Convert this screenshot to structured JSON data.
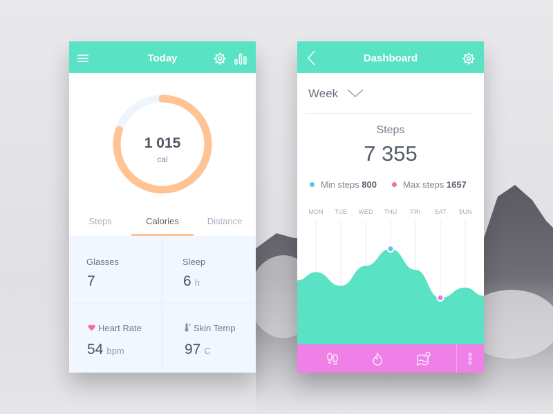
{
  "colors": {
    "teal": "#59e2c4",
    "orange": "#ffc394",
    "ring_track": "#eef5fd",
    "pink_bar": "#ef80e8",
    "min_dot": "#5cc2f0",
    "max_dot": "#ee6fa8",
    "heart": "#f2709f"
  },
  "today": {
    "title": "Today",
    "icons": [
      "menu-icon",
      "gear-icon",
      "bar-chart-icon"
    ],
    "ring": {
      "value": "1 015",
      "unit": "cal",
      "progress": 0.8
    },
    "tabs": [
      {
        "label": "Steps",
        "active": false
      },
      {
        "label": "Calories",
        "active": true
      },
      {
        "label": "Distance",
        "active": false
      }
    ],
    "stats": [
      {
        "label": "Glasses",
        "value": "7",
        "unit": "",
        "icon": ""
      },
      {
        "label": "Sleep",
        "value": "6",
        "unit": "h",
        "icon": ""
      },
      {
        "label": "Heart Rate",
        "value": "54",
        "unit": "bpm",
        "icon": "heart-icon"
      },
      {
        "label": "Skin Temp",
        "value": "97",
        "unit": "C",
        "icon": "thermometer-icon"
      }
    ]
  },
  "dashboard": {
    "title": "Dashboard",
    "icons": [
      "back-icon",
      "gear-icon"
    ],
    "period": "Week",
    "steps_label": "Steps",
    "steps_value": "7 355",
    "min_label": "Min steps",
    "min_value": "800",
    "max_label": "Max steps",
    "max_value": "1657",
    "bottom_icons": [
      "footsteps-icon",
      "flame-icon",
      "map-icon",
      "more-vertical-icon"
    ]
  },
  "chart_data": {
    "type": "area",
    "title": "Steps",
    "categories": [
      "MON",
      "TUE",
      "WED",
      "THU",
      "FRI",
      "SAT",
      "SUN"
    ],
    "values": [
      1250,
      1010,
      1360,
      1657,
      1290,
      800,
      980
    ],
    "highlight": {
      "max_index": 3,
      "min_index": 5
    },
    "ylim": [
      0,
      2050
    ],
    "grid": "vertical",
    "legend": "top"
  }
}
